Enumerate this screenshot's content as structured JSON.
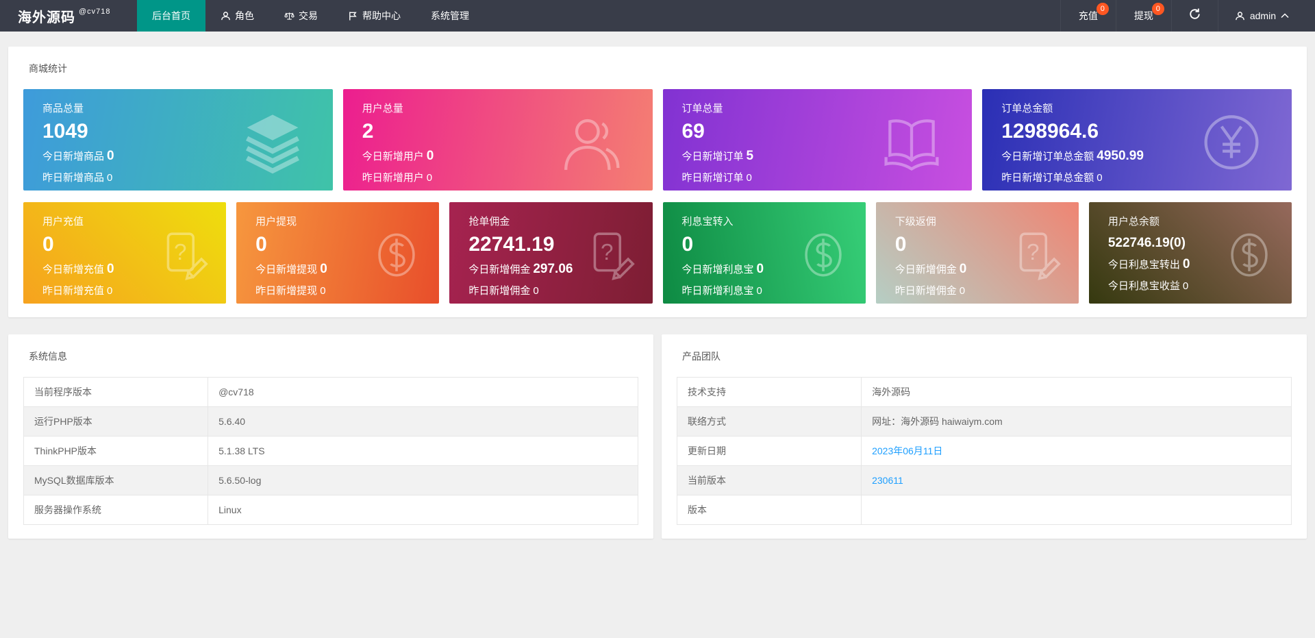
{
  "navbar": {
    "brand": "海外源码",
    "brand_sub": "@cv718",
    "menu": [
      {
        "key": "home",
        "label": "后台首页",
        "icon": null,
        "active": true
      },
      {
        "key": "role",
        "label": "角色",
        "icon": "user-icon",
        "active": false
      },
      {
        "key": "trade",
        "label": "交易",
        "icon": "scales-icon",
        "active": false
      },
      {
        "key": "help",
        "label": "帮助中心",
        "icon": "flag-icon",
        "active": false
      },
      {
        "key": "system",
        "label": "系统管理",
        "icon": null,
        "active": false
      }
    ],
    "actions": [
      {
        "key": "recharge",
        "label": "充值",
        "badge": "0"
      },
      {
        "key": "withdraw",
        "label": "提现",
        "badge": "0"
      }
    ],
    "user": "admin",
    "badge_color": "#FF5722",
    "active_color": "#009688"
  },
  "stats": {
    "title": "商城统计",
    "cards_row1": [
      {
        "key": "goods-total",
        "title": "商品总量",
        "value": "1049",
        "small_value": false,
        "line2_label": "今日新增商品",
        "line2_value": "0",
        "line3_label": "昨日新增商品",
        "line3_value": "0",
        "icon": "layers-icon",
        "gradient": [
          "#3e9bdb",
          "#3fc3a8"
        ],
        "angle": "100deg"
      },
      {
        "key": "user-total",
        "title": "用户总量",
        "value": "2",
        "small_value": false,
        "line2_label": "今日新增用户",
        "line2_value": "0",
        "line3_label": "昨日新增用户",
        "line3_value": "0",
        "icon": "person-icon",
        "gradient": [
          "#ec1e8f",
          "#f47f72"
        ],
        "angle": "100deg"
      },
      {
        "key": "order-total",
        "title": "订单总量",
        "value": "69",
        "small_value": false,
        "line2_label": "今日新增订单",
        "line2_value": "5",
        "line3_label": "昨日新增订单",
        "line3_value": "0",
        "icon": "book-icon",
        "gradient": [
          "#8132d2",
          "#c84fe0"
        ],
        "angle": "100deg"
      },
      {
        "key": "order-amount",
        "title": "订单总金额",
        "value": "1298964.6",
        "small_value": false,
        "line2_label": "今日新增订单总金额",
        "line2_value": "4950.99",
        "line3_label": "昨日新增订单总金额",
        "line3_value": "0",
        "icon": "yen-icon",
        "gradient": [
          "#2a2fb5",
          "#7f68d3"
        ],
        "angle": "100deg"
      }
    ],
    "cards_row2": [
      {
        "key": "user-recharge",
        "title": "用户充值",
        "value": "0",
        "small_value": false,
        "line2_label": "今日新增充值",
        "line2_value": "0",
        "line3_label": "昨日新增充值",
        "line3_value": "0",
        "icon": "doc-question-icon",
        "gradient": [
          "#f6a21f",
          "#eede0d"
        ],
        "angle": "45deg"
      },
      {
        "key": "user-withdraw",
        "title": "用户提现",
        "value": "0",
        "small_value": false,
        "line2_label": "今日新增提现",
        "line2_value": "0",
        "line3_label": "昨日新增提现",
        "line3_value": "0",
        "icon": "dollar-icon",
        "gradient": [
          "#f6973e",
          "#e84e2b"
        ],
        "angle": "100deg"
      },
      {
        "key": "grab-commission",
        "title": "抢单佣金",
        "value": "22741.19",
        "small_value": false,
        "line2_label": "今日新增佣金",
        "line2_value": "297.06",
        "line3_label": "昨日新增佣金",
        "line3_value": "0",
        "icon": "doc-question-icon",
        "gradient": [
          "#a62350",
          "#7d1e33"
        ],
        "angle": "100deg"
      },
      {
        "key": "interest-in",
        "title": "利息宝转入",
        "value": "0",
        "small_value": false,
        "line2_label": "今日新增利息宝",
        "line2_value": "0",
        "line3_label": "昨日新增利息宝",
        "line3_value": "0",
        "icon": "dollar-icon",
        "gradient": [
          "#0e8a43",
          "#36ce77"
        ],
        "angle": "80deg"
      },
      {
        "key": "sub-commission",
        "title": "下级返佣",
        "value": "0",
        "small_value": false,
        "line2_label": "今日新增佣金",
        "line2_value": "0",
        "line3_label": "昨日新增佣金",
        "line3_value": "0",
        "icon": "doc-question-icon",
        "gradient": [
          "#b5cec4",
          "#ef8573"
        ],
        "angle": "45deg"
      },
      {
        "key": "user-balance",
        "title": "用户总余额",
        "value": "522746.19(0)",
        "small_value": true,
        "line2_label": "今日利息宝转出",
        "line2_value": "0",
        "line3_label": "今日利息宝收益",
        "line3_value": "0",
        "icon": "dollar-icon",
        "gradient": [
          "#35390f",
          "#96695c"
        ],
        "angle": "45deg"
      }
    ]
  },
  "system_info": {
    "title": "系统信息",
    "rows": [
      {
        "label": "当前程序版本",
        "value": "@cv718",
        "link": false
      },
      {
        "label": "运行PHP版本",
        "value": "5.6.40",
        "link": false
      },
      {
        "label": "ThinkPHP版本",
        "value": "5.1.38 LTS",
        "link": false
      },
      {
        "label": "MySQL数据库版本",
        "value": "5.6.50-log",
        "link": false
      },
      {
        "label": "服务器操作系统",
        "value": "Linux",
        "link": false
      }
    ]
  },
  "product_team": {
    "title": "产品团队",
    "rows": [
      {
        "label": "技术支持",
        "value": "海外源码",
        "link": false
      },
      {
        "label": "联络方式",
        "value": "网址：海外源码 haiwaiym.com",
        "link": false
      },
      {
        "label": "更新日期",
        "value": "2023年06月11日",
        "link": true
      },
      {
        "label": "当前版本",
        "value": "230611",
        "link": true
      },
      {
        "label": "版本",
        "value": "",
        "link": false
      }
    ]
  }
}
